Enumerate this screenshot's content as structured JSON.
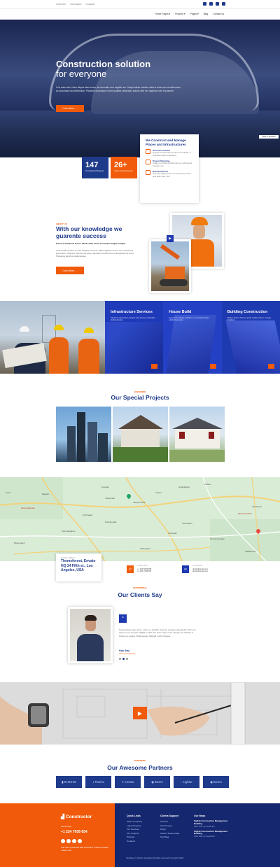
{
  "topbar": {
    "links": [
      "SUPPORT",
      "PARTNERS",
      "CAREER"
    ],
    "social_icons": [
      "twitter-icon",
      "facebook-icon",
      "linkedin-icon",
      "youtube-icon"
    ]
  },
  "nav": {
    "items": [
      "Home Pages",
      "Projects",
      "Pages",
      "Blog",
      "Contact us"
    ]
  },
  "hero": {
    "title_line1": "Construction solution",
    "title_line2": "for everyone",
    "body": "In id enim odio. Nunc aliquet diam lorem, at venenatis urna sagittis non. Suspendisse sodales nulla ut amet sem condimentum, ac accumsan nisl elementum. Praesent accumsan et sem sodales venenatis. Mauris nibh nec dapibus enim in posuere.",
    "cta": "Learn More →",
    "badge": "Made in Webflow"
  },
  "stats": [
    {
      "value": "147",
      "label": "Completed Projects",
      "color": "#1e3a8a"
    },
    {
      "value": "26+",
      "label": "Years of Experience",
      "color": "#f05a0a"
    }
  ],
  "build_card": {
    "title": "We Construct and Manage Places and Infrastructures",
    "items": [
      {
        "title": "General Contract",
        "text": "Quisque condimentum tincid ac orci blandit, in sollicitudin tellus scelerisque."
      },
      {
        "title": "Project Planning",
        "text": "Nullam commodo tincidunt est non vehicula dui interdum nec."
      },
      {
        "title": "Refurbishment",
        "text": "Sed vitae aliquet ipsum at ornare lectus. Proin ante diam, facil nunc."
      }
    ]
  },
  "about": {
    "tag": "ABOUT US",
    "title": "With our knowledge we guarente success",
    "lead": "Fusce id hendrerit lectus. Morbi vitae tortor sed turpis feugiat congue.",
    "body": "Cras tincidunt tellus at ante tristique rhoncus. Etiam dapibus rutrum leo consectetur accumsan. Vivamus viverra ante justo, dignissim condimentum elit egestas sit amet. Phasellus faucibus pellentesque.",
    "cta": "Learn More →"
  },
  "services": [
    {
      "title": "Infrastructure Services",
      "text": "Vivamus elementum semper nisi. Aenean vulputate eleifend tellus."
    },
    {
      "title": "House Build",
      "text": "Aenean leo ligula, porttitor eu consequat vitae, eleifend ac enim."
    },
    {
      "title": "Building Construction",
      "text": "Nullam dictum felis eu pede mollis pretium. Integer tincidunt."
    }
  ],
  "projects": {
    "tag": "OUR WORK",
    "title": "Our Special Projects"
  },
  "map": {
    "places": [
      "Kuppam",
      "Kaveripattinam",
      "Krishnagiri",
      "Dharmapuri",
      "Karimangalam",
      "Tiruvannamalai",
      "Vaniyambadi",
      "Ambur",
      "Gudiyatham",
      "Vellore",
      "Pochampalli",
      "Jolarpettai",
      "Chengam",
      "Uthangarai",
      "Hosur",
      "Bagalur",
      "Kallakurichi",
      "Melmaruvathur",
      "Vettavalam",
      "Vandavasi"
    ]
  },
  "contact": {
    "address_label": "Contact / Address",
    "address": "Themeforest, Envato HQ 24 Fifth st., Los Angeles, USA",
    "phone_label": "Contact Phone",
    "phones": [
      "+1 234 5678 098",
      "+1 234 7638 654"
    ],
    "email_label": "Contact Email",
    "emails": [
      "dustin@gmail.com",
      "dustin@gmail.com"
    ]
  },
  "testimonial": {
    "tag": "TESTIMONIAL",
    "title": "Our Clients Say",
    "text": "Suspendisse tortor enim, rutrum et porttitor sit amet, posuere vitae lectus. Proin ac quam in orci semper sagittis in vitae elit. Nam neque erat, semper vel ultricies in, finibus eu magna. Pellentesque habitant morbi tristique.",
    "name": "Katy Gray",
    "role": "CFO Ford industries"
  },
  "partners": {
    "tag": "PARTNERS",
    "title": "Our Awesome Partners",
    "logos": [
      "DHSIHIS",
      "Rosino",
      "envato",
      "Bexim",
      "Lighter",
      "Bexim"
    ]
  },
  "footer": {
    "logo": "Constructor",
    "call_label": "Call to Today",
    "phone": "+1 234 7638 654",
    "desc": "Cras quis mi pede with effici tal tincidunt. Vivamus vehicula neque a sed.",
    "col1_title": "Quick Links",
    "col1": [
      "About Company",
      "Latest Projects",
      "Our Services",
      "Our Projects",
      "Pricings",
      "Contacts"
    ],
    "col2_title": "Clients Support",
    "col2": [
      "Careers",
      "Our Process",
      "FAQs",
      "Clients Testimonials",
      "Our Blog"
    ],
    "col3_title": "Our News",
    "news": [
      {
        "title": "Sigfrid Construction Management Building",
        "meta": "8 Nov 2020 / by Investiment"
      },
      {
        "title": "Sigfrid Construction Management Building",
        "meta": "8 Nov 2020 / by Investiment"
      }
    ],
    "copyright": "Flowbase © Davilcs Templates All rights reserved Copyrights 2020"
  },
  "colors": {
    "primary": "#1e3a8a",
    "accent": "#f05a0a"
  }
}
